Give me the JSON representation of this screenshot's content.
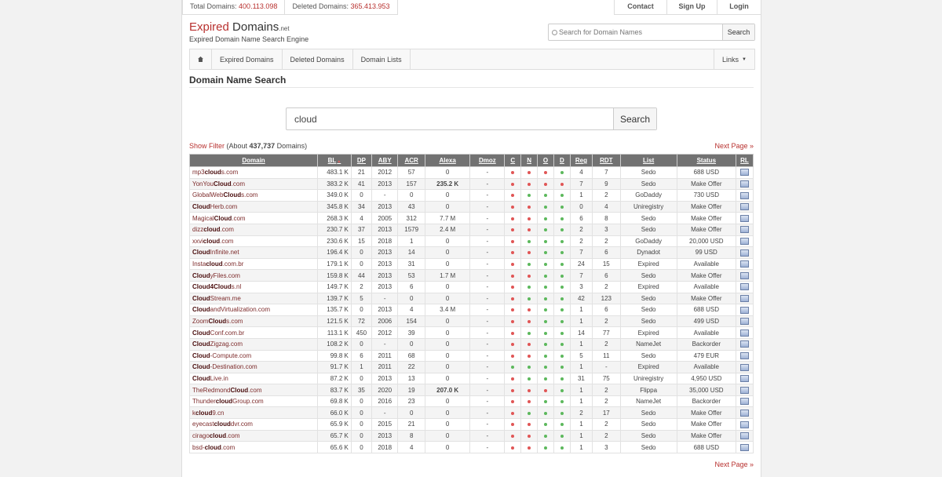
{
  "stats": {
    "total_label": "Total Domains:",
    "total_value": "400.113.098",
    "deleted_label": "Deleted Domains:",
    "deleted_value": "365.413.953"
  },
  "topnav": [
    "Contact",
    "Sign Up",
    "Login"
  ],
  "logo": {
    "part1": "Expired",
    "part2": " Domains",
    "part3": ".net",
    "subtitle": "Expired Domain Name Search Engine"
  },
  "header_search": {
    "placeholder": "Search for Domain Names",
    "button": "Search"
  },
  "mainnav": {
    "items": [
      "Expired Domains",
      "Deleted Domains",
      "Domain Lists"
    ],
    "links": "Links"
  },
  "page_title": "Domain Name Search",
  "search": {
    "value": "cloud",
    "button": "Search"
  },
  "filter": {
    "show_filter": "Show Filter",
    "about_prefix": " (About ",
    "count": "437,737",
    "about_suffix": " Domains)"
  },
  "next_page": "Next Page »",
  "table": {
    "columns": [
      "Domain",
      "BL",
      "DP",
      "ABY",
      "ACR",
      "Alexa",
      "Dmoz",
      "C",
      "N",
      "O",
      "D",
      "Reg",
      "RDT",
      "List",
      "Status",
      "RL"
    ],
    "rows": [
      {
        "pre": "mp3",
        "kw": "cloud",
        "post": "s.com",
        "bl": "483.1 K",
        "dp": "21",
        "aby": "2012",
        "acr": "57",
        "alexa": "0",
        "dmoz": "-",
        "c": "red",
        "n": "red",
        "o": "red",
        "d": "green",
        "reg": "4",
        "rdt": "7",
        "list": "Sedo",
        "status": "688 USD",
        "sc": "orange"
      },
      {
        "pre": "YonYou",
        "kw": "Cloud",
        "post": ".com",
        "bl": "383.2 K",
        "dp": "41",
        "aby": "2013",
        "acr": "157",
        "alexa": "235.2 K",
        "ab": true,
        "dmoz": "-",
        "c": "red",
        "n": "red",
        "o": "red",
        "d": "red",
        "reg": "7",
        "rdt": "9",
        "list": "Sedo",
        "status": "Make Offer",
        "sc": "orange"
      },
      {
        "pre": "GlobalWeb",
        "kw": "Cloud",
        "post": "s.com",
        "bl": "349.0 K",
        "dp": "0",
        "aby": "-",
        "acr": "0",
        "alexa": "0",
        "dmoz": "-",
        "c": "red",
        "n": "green",
        "o": "green",
        "d": "green",
        "reg": "1",
        "rdt": "2",
        "list": "GoDaddy",
        "status": "730 USD",
        "sc": "green"
      },
      {
        "pre": "",
        "kw": "Cloud",
        "post": "Herb.com",
        "bl": "345.8 K",
        "dp": "34",
        "aby": "2013",
        "acr": "43",
        "alexa": "0",
        "dmoz": "-",
        "c": "red",
        "n": "red",
        "o": "green",
        "d": "green",
        "reg": "0",
        "rdt": "4",
        "list": "Uniregistry",
        "status": "Make Offer",
        "sc": "orange"
      },
      {
        "pre": "Magical",
        "kw": "Cloud",
        "post": ".com",
        "bl": "268.3 K",
        "dp": "4",
        "aby": "2005",
        "acr": "312",
        "alexa": "7.7 M",
        "dmoz": "-",
        "c": "red",
        "n": "red",
        "o": "green",
        "d": "green",
        "reg": "6",
        "rdt": "8",
        "list": "Sedo",
        "status": "Make Offer",
        "sc": "orange"
      },
      {
        "pre": "dizz",
        "kw": "cloud",
        "post": ".com",
        "bl": "230.7 K",
        "dp": "37",
        "aby": "2013",
        "acr": "1579",
        "alexa": "2.4 M",
        "dmoz": "-",
        "c": "red",
        "n": "red",
        "o": "green",
        "d": "green",
        "reg": "2",
        "rdt": "3",
        "list": "Sedo",
        "status": "Make Offer",
        "sc": "orange"
      },
      {
        "pre": "xxvi",
        "kw": "cloud",
        "post": ".com",
        "bl": "230.6 K",
        "dp": "15",
        "aby": "2018",
        "acr": "1",
        "alexa": "0",
        "dmoz": "-",
        "c": "red",
        "n": "green",
        "o": "green",
        "d": "green",
        "reg": "2",
        "rdt": "2",
        "list": "GoDaddy",
        "status": "20,000 USD",
        "sc": "green"
      },
      {
        "pre": "",
        "kw": "Cloud",
        "post": "Infinite.net",
        "bl": "196.4 K",
        "dp": "0",
        "aby": "2013",
        "acr": "14",
        "alexa": "0",
        "dmoz": "-",
        "c": "red",
        "n": "red",
        "o": "green",
        "d": "green",
        "reg": "7",
        "rdt": "6",
        "list": "Dynadot",
        "status": "99 USD",
        "sc": "green"
      },
      {
        "pre": "Insta",
        "kw": "cloud",
        "post": ".com.br",
        "bl": "179.1 K",
        "dp": "0",
        "aby": "2013",
        "acr": "31",
        "alexa": "0",
        "dmoz": "-",
        "c": "red",
        "n": "green",
        "o": "green",
        "d": "green",
        "reg": "24",
        "rdt": "15",
        "list": "Expired",
        "status": "Available",
        "sc": "green"
      },
      {
        "pre": "",
        "kw": "Cloud",
        "post": "yFiles.com",
        "bl": "159.8 K",
        "dp": "44",
        "aby": "2013",
        "acr": "53",
        "alexa": "1.7 M",
        "dmoz": "-",
        "c": "red",
        "n": "red",
        "o": "green",
        "d": "green",
        "reg": "7",
        "rdt": "6",
        "list": "Sedo",
        "status": "Make Offer",
        "sc": "orange"
      },
      {
        "pre": "",
        "kw": "Cloud4Cloud",
        "post": "s.nl",
        "bl": "149.7 K",
        "dp": "2",
        "aby": "2013",
        "acr": "6",
        "alexa": "0",
        "dmoz": "-",
        "c": "red",
        "n": "green",
        "o": "green",
        "d": "green",
        "reg": "3",
        "rdt": "2",
        "list": "Expired",
        "status": "Available",
        "sc": "green"
      },
      {
        "pre": "",
        "kw": "Cloud",
        "post": "Stream.me",
        "bl": "139.7 K",
        "dp": "5",
        "aby": "-",
        "acr": "0",
        "alexa": "0",
        "dmoz": "-",
        "c": "red",
        "n": "green",
        "o": "green",
        "d": "green",
        "reg": "42",
        "rdt": "123",
        "list": "Sedo",
        "status": "Make Offer",
        "sc": "orange"
      },
      {
        "pre": "",
        "kw": "Cloud",
        "post": "andVirtualization.com",
        "bl": "135.7 K",
        "dp": "0",
        "aby": "2013",
        "acr": "4",
        "alexa": "3.4 M",
        "dmoz": "-",
        "c": "red",
        "n": "red",
        "o": "green",
        "d": "green",
        "reg": "1",
        "rdt": "6",
        "list": "Sedo",
        "status": "688 USD",
        "sc": "orange"
      },
      {
        "pre": "Zoom",
        "kw": "Cloud",
        "post": "s.com",
        "bl": "121.5 K",
        "dp": "72",
        "aby": "2006",
        "acr": "154",
        "alexa": "0",
        "dmoz": "-",
        "c": "red",
        "n": "red",
        "o": "green",
        "d": "green",
        "reg": "1",
        "rdt": "2",
        "list": "Sedo",
        "status": "499 USD",
        "sc": "green"
      },
      {
        "pre": "",
        "kw": "Cloud",
        "post": "Conf.com.br",
        "bl": "113.1 K",
        "dp": "450",
        "aby": "2012",
        "acr": "39",
        "alexa": "0",
        "dmoz": "-",
        "c": "red",
        "n": "green",
        "o": "green",
        "d": "green",
        "reg": "14",
        "rdt": "77",
        "list": "Expired",
        "status": "Available",
        "sc": "green"
      },
      {
        "pre": "",
        "kw": "Cloud",
        "post": "Zigzag.com",
        "bl": "108.2 K",
        "dp": "0",
        "aby": "-",
        "acr": "0",
        "alexa": "0",
        "dmoz": "-",
        "c": "red",
        "n": "red",
        "o": "green",
        "d": "green",
        "reg": "1",
        "rdt": "2",
        "list": "NameJet",
        "status": "Backorder",
        "sc": "dark"
      },
      {
        "pre": "",
        "kw": "Cloud",
        "post": "-Compute.com",
        "bl": "99.8 K",
        "dp": "6",
        "aby": "2011",
        "acr": "68",
        "alexa": "0",
        "dmoz": "-",
        "c": "red",
        "n": "red",
        "o": "green",
        "d": "green",
        "reg": "5",
        "rdt": "11",
        "list": "Sedo",
        "status": "479 EUR",
        "sc": "green"
      },
      {
        "pre": "",
        "kw": "Cloud",
        "post": "-Destination.com",
        "bl": "91.7 K",
        "dp": "1",
        "aby": "2011",
        "acr": "22",
        "alexa": "0",
        "dmoz": "-",
        "c": "green",
        "n": "green",
        "o": "green",
        "d": "green",
        "reg": "1",
        "rdt": "-",
        "list": "Expired",
        "status": "Available",
        "sc": "green"
      },
      {
        "pre": "",
        "kw": "Cloud",
        "post": "Live.in",
        "bl": "87.2 K",
        "dp": "0",
        "aby": "2013",
        "acr": "13",
        "alexa": "0",
        "dmoz": "-",
        "c": "red",
        "n": "green",
        "o": "green",
        "d": "green",
        "reg": "31",
        "rdt": "75",
        "list": "Uniregistry",
        "status": "4,950 USD",
        "sc": "green"
      },
      {
        "pre": "TheRedmond",
        "kw": "Cloud",
        "post": ".com",
        "bl": "83.7 K",
        "dp": "35",
        "aby": "2020",
        "acr": "19",
        "alexa": "207.0 K",
        "ab": true,
        "dmoz": "-",
        "c": "red",
        "n": "red",
        "o": "red",
        "d": "green",
        "reg": "1",
        "rdt": "2",
        "list": "Flippa",
        "status": "35,000 USD",
        "sc": "orange"
      },
      {
        "pre": "Thunder",
        "kw": "cloud",
        "post": "Group.com",
        "bl": "69.8 K",
        "dp": "0",
        "aby": "2016",
        "acr": "23",
        "alexa": "0",
        "dmoz": "-",
        "c": "red",
        "n": "red",
        "o": "green",
        "d": "green",
        "reg": "1",
        "rdt": "2",
        "list": "NameJet",
        "status": "Backorder",
        "sc": "dark"
      },
      {
        "pre": "k",
        "kw": "cloud",
        "post": "9.cn",
        "bl": "66.0 K",
        "dp": "0",
        "aby": "-",
        "acr": "0",
        "alexa": "0",
        "dmoz": "-",
        "c": "red",
        "n": "green",
        "o": "green",
        "d": "green",
        "reg": "2",
        "rdt": "17",
        "list": "Sedo",
        "status": "Make Offer",
        "sc": "orange"
      },
      {
        "pre": "eyecast",
        "kw": "cloud",
        "post": "dvr.com",
        "bl": "65.9 K",
        "dp": "0",
        "aby": "2015",
        "acr": "21",
        "alexa": "0",
        "dmoz": "-",
        "c": "red",
        "n": "red",
        "o": "green",
        "d": "green",
        "reg": "1",
        "rdt": "2",
        "list": "Sedo",
        "status": "Make Offer",
        "sc": "orange"
      },
      {
        "pre": "cirago",
        "kw": "cloud",
        "post": ".com",
        "bl": "65.7 K",
        "dp": "0",
        "aby": "2013",
        "acr": "8",
        "alexa": "0",
        "dmoz": "-",
        "c": "red",
        "n": "red",
        "o": "green",
        "d": "green",
        "reg": "1",
        "rdt": "2",
        "list": "Sedo",
        "status": "Make Offer",
        "sc": "orange"
      },
      {
        "pre": "bsd-",
        "kw": "cloud",
        "post": ".com",
        "bl": "65.6 K",
        "dp": "0",
        "aby": "2018",
        "acr": "4",
        "alexa": "0",
        "dmoz": "-",
        "c": "red",
        "n": "red",
        "o": "green",
        "d": "green",
        "reg": "1",
        "rdt": "3",
        "list": "Sedo",
        "status": "688 USD",
        "sc": "green"
      }
    ]
  }
}
